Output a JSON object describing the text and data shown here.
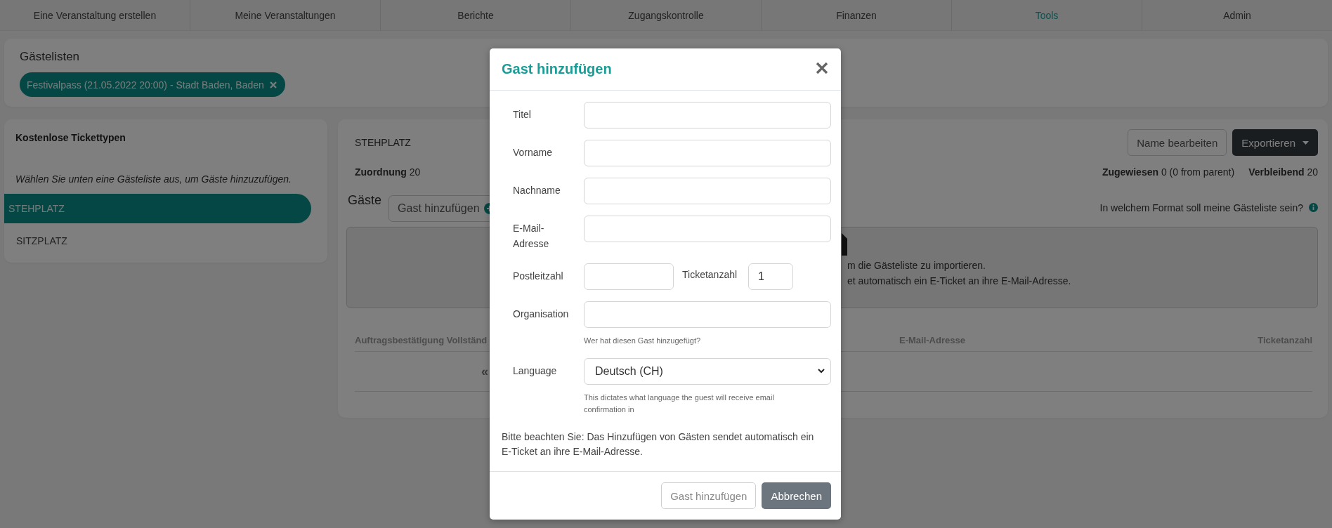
{
  "nav": [
    {
      "label": "Eine Veranstaltung erstellen",
      "selected": false
    },
    {
      "label": "Meine Veranstaltungen",
      "selected": false
    },
    {
      "label": "Berichte",
      "selected": false
    },
    {
      "label": "Zugangskontrolle",
      "selected": false
    },
    {
      "label": "Finanzen",
      "selected": false
    },
    {
      "label": "Tools",
      "selected": true
    },
    {
      "label": "Admin",
      "selected": false
    }
  ],
  "guest_lists": {
    "title": "Gästelisten",
    "chips": [
      {
        "label": "Festivalpass (21.05.2022 20:00) - Stadt Baden, Baden"
      }
    ]
  },
  "ticket_types": {
    "title": "Kostenlose Tickettypen",
    "hint": "Wählen Sie unten eine Gästeliste aus, um Gäste hinzuzufügen.",
    "items": [
      {
        "label": "STEHPLATZ",
        "selected": true
      },
      {
        "label": "SITZPLATZ",
        "selected": false
      }
    ]
  },
  "detail": {
    "name": "STEHPLATZ",
    "buttons": [
      {
        "label": "Name bearbeiten",
        "kind": "outline"
      },
      {
        "label": "Exportieren",
        "kind": "dropdown"
      }
    ],
    "allocation": {
      "label": "Zuordnung",
      "value": "20"
    },
    "stats": [
      {
        "label": "Zugewiesen",
        "value": "0 (0 from parent)"
      },
      {
        "label": "Verbleibend",
        "value": "20"
      }
    ],
    "guests_heading": "Gäste",
    "add_guest_button": "Gast hinzufügen",
    "format_hint": "In welchem Format soll meine Gästeliste sein?",
    "dropzone_lines": [
      "m die Gästeliste zu importieren.",
      "et automatisch ein E-Ticket an ihre E-Mail-Adresse."
    ],
    "columns": [
      "Auftragsbestätigung Vollständ",
      "E-Mail-Adresse",
      "Ticketanzahl"
    ],
    "pagination": "«"
  },
  "modal": {
    "title": "Gast hinzufügen",
    "fields": [
      {
        "kind": "text",
        "label": "Titel"
      },
      {
        "kind": "text",
        "label": "Vorname"
      },
      {
        "kind": "text",
        "label": "Nachname"
      },
      {
        "kind": "text",
        "label": "E-Mail-Adresse"
      },
      {
        "kind": "pair",
        "label": "Postleitzahl",
        "label_2": "Ticketanzahl",
        "value_2": "1"
      },
      {
        "kind": "text",
        "label": "Organisation",
        "help": "Wer hat diesen Gast hinzugefügt?"
      },
      {
        "kind": "select",
        "label": "Language",
        "value": "Deutsch (CH)",
        "help": "This dictates what language the guest will receive email confirmation in"
      }
    ],
    "note": "Bitte beachten Sie: Das Hinzufügen von Gästen sendet automatisch ein E-Ticket an ihre E-Mail-Adresse.",
    "buttons": [
      {
        "label": "Gast hinzufügen",
        "kind": "outline"
      },
      {
        "label": "Abbrechen",
        "kind": "secondary"
      }
    ]
  }
}
